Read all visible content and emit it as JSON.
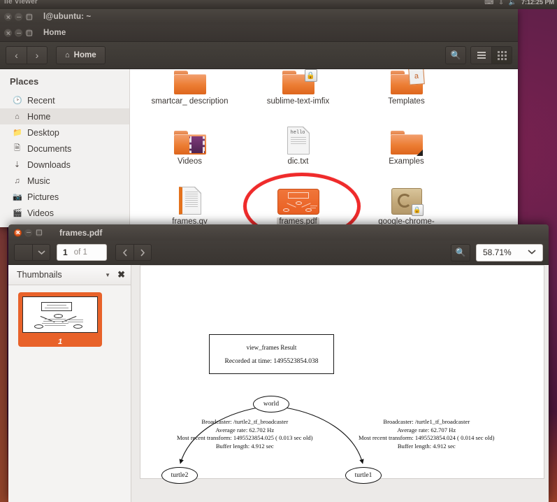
{
  "top_panel": {
    "app_title": "ile Viewer",
    "indicators": [
      "keyboard-icon",
      "download-icon",
      "sound-icon"
    ],
    "clock": "7:12:25 PM"
  },
  "file_manager": {
    "window_title_outer": "l@ubuntu: ~",
    "window_title": "Home",
    "toolbar": {
      "back_label": "‹",
      "forward_label": "›",
      "path_label": "Home",
      "search_icon": "search-icon",
      "list_view_icon": "list-view-icon",
      "grid_view_icon": "grid-view-icon"
    },
    "sidebar": {
      "header": "Places",
      "items": [
        {
          "label": "Recent",
          "icon": "clock-icon",
          "active": false
        },
        {
          "label": "Home",
          "icon": "home-icon",
          "active": true
        },
        {
          "label": "Desktop",
          "icon": "desktop-icon",
          "active": false
        },
        {
          "label": "Documents",
          "icon": "document-icon",
          "active": false
        },
        {
          "label": "Downloads",
          "icon": "download-icon",
          "active": false
        },
        {
          "label": "Music",
          "icon": "music-icon",
          "active": false
        },
        {
          "label": "Pictures",
          "icon": "camera-icon",
          "active": false
        },
        {
          "label": "Videos",
          "icon": "video-icon",
          "active": false
        }
      ]
    },
    "files": [
      {
        "label": "smartcar_\ndescription",
        "type": "folder",
        "selected": false
      },
      {
        "label": "sublime-text-imfix",
        "type": "folder-lock",
        "selected": false
      },
      {
        "label": "Templates",
        "type": "folder-tmpl",
        "selected": false
      },
      {
        "label": "Videos",
        "type": "folder-film",
        "selected": false
      },
      {
        "label": "dic.txt",
        "type": "text-doc",
        "selected": false,
        "preview": "hello"
      },
      {
        "label": "Examples",
        "type": "folder-link",
        "selected": false
      },
      {
        "label": "frames.gv",
        "type": "gv-doc",
        "selected": false
      },
      {
        "label": "frames.pdf",
        "type": "pdf-thumb",
        "selected": true
      },
      {
        "label": "google-chrome-",
        "type": "package",
        "selected": false
      }
    ],
    "annotation": {
      "shape": "red-ellipse",
      "color": "#ef2b2b",
      "targets": "frames.pdf"
    }
  },
  "pdf_viewer": {
    "window_title": "frames.pdf",
    "toolbar": {
      "page_up_icon": "chevron-up-icon",
      "page_down_icon": "chevron-down-icon",
      "page_number": "1",
      "page_total": "of 1",
      "prev_icon": "chevron-left-icon",
      "next_icon": "chevron-right-icon",
      "search_icon": "search-icon",
      "zoom_value": "58.71%",
      "zoom_caret_icon": "chevron-down-icon"
    },
    "side_pane": {
      "title": "Thumbnails",
      "caret_icon": "chevron-down-icon",
      "close_icon": "close-icon",
      "thumbnails": [
        {
          "page_label": "1",
          "selected": true
        }
      ]
    },
    "document": {
      "title_box": {
        "heading": "view_frames Result",
        "recorded": "Recorded at time: 1495523854.038"
      },
      "nodes": [
        {
          "id": "world",
          "label": "world"
        },
        {
          "id": "turtle2",
          "label": "turtle2"
        },
        {
          "id": "turtle1",
          "label": "turtle1"
        }
      ],
      "edges": [
        {
          "from": "world",
          "to": "turtle2",
          "lines": [
            "Broadcaster: /turtle2_tf_broadcaster",
            "Average rate: 62.702 Hz",
            "Most recent transform: 1495523854.025 ( 0.013 sec old)",
            "Buffer length: 4.912 sec"
          ]
        },
        {
          "from": "world",
          "to": "turtle1",
          "lines": [
            "Broadcaster: /turtle1_tf_broadcaster",
            "Average rate: 62.707 Hz",
            "Most recent transform: 1495523854.024 ( 0.014 sec old)",
            "Buffer length: 4.912 sec"
          ]
        }
      ]
    }
  },
  "colors": {
    "accent_orange": "#e8622a",
    "annotation_red": "#ef2b2b",
    "desktop_purple": "#5d1a42",
    "chrome_dark": "#3c3733"
  }
}
